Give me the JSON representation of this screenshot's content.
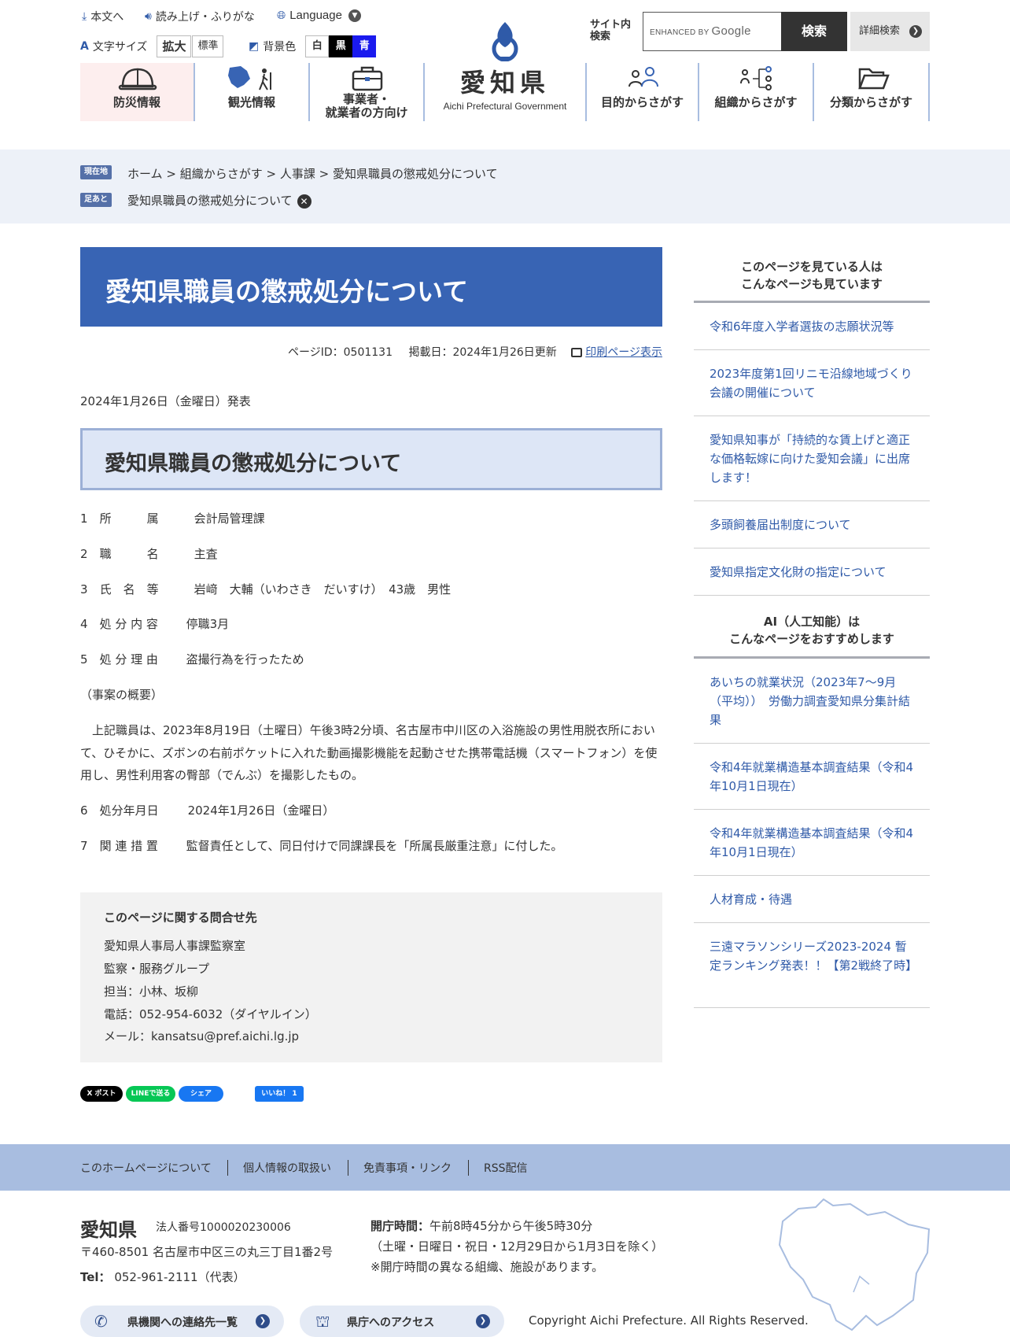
{
  "header": {
    "skip": "本文へ",
    "read_aloud": "読み上げ・ふりがな",
    "language": "Language",
    "font_size_label": "文字サイズ",
    "font_large": "拡大",
    "font_standard": "標準",
    "bg_color_label": "背景色",
    "bg_white": "白",
    "bg_black": "黒",
    "bg_blue": "青",
    "logo_jp": "愛知県",
    "logo_en": "Aichi Prefectural Government",
    "search_label_1": "サイト内",
    "search_label_2": "検索",
    "search_enhanced": "ENHANCED BY",
    "search_google": "Google",
    "search_button": "検索",
    "advanced_search": "詳細検索"
  },
  "nav": {
    "bosai": "防災情報",
    "kanko": "観光情報",
    "jigyo_1": "事業者・",
    "jigyo_2": "就業者の方向け",
    "mokuteki": "目的からさがす",
    "soshiki": "組織からさがす",
    "bunrui": "分類からさがす"
  },
  "breadcrumb": {
    "current_tag": "現在地",
    "home": "ホーム",
    "org": "組織からさがす",
    "dept": "人事課",
    "page": "愛知県職員の懲戒処分について",
    "sep": ">",
    "history_tag": "足あと",
    "history_item": "愛知県職員の懲戒処分について"
  },
  "article": {
    "title": "愛知県職員の懲戒処分について",
    "page_id": "ページID：0501131",
    "posted": "掲載日：2024年1月26日更新",
    "print": "印刷ページ表示",
    "announce": "2024年1月26日（金曜日）発表",
    "heading": "愛知県職員の懲戒処分について",
    "items": [
      {
        "num": "1",
        "label": "所　　　属",
        "value": "会計局管理課"
      },
      {
        "num": "2",
        "label": "職　　　名",
        "value": "主査"
      },
      {
        "num": "3",
        "label": "氏　名　等",
        "value": "岩﨑　大輔（いわさき　だいすけ）　43歳　男性"
      },
      {
        "num": "4",
        "label": "処 分 内 容",
        "value": "停職3月"
      },
      {
        "num": "5",
        "label": "処 分 理 由",
        "value": "盗撮行為を行ったため"
      }
    ],
    "summary_label": "（事案の概要）",
    "summary": "　上記職員は、2023年8月19日（土曜日）午後3時2分頃、名古屋市中川区の入浴施設の男性用脱衣所において、ひそかに、ズボンの右前ポケットに入れた動画撮影機能を起動させた携帯電話機（スマートフォン）を使用し、男性利用客の臀部（でんぶ）を撮影したもの。",
    "items2": [
      {
        "num": "6",
        "label": "処分年月日",
        "value": "2024年1月26日（金曜日）"
      },
      {
        "num": "7",
        "label": "関 連 措 置",
        "value": "監督責任として、同日付けで同課課長を「所属長厳重注意」に付した。"
      }
    ]
  },
  "contact": {
    "title": "このページに関する問合せ先",
    "lines": [
      "愛知県人事局人事課監察室",
      "監察・服務グループ",
      "担当：小林、坂柳",
      "電話：052-954-6032（ダイヤルイン）",
      "メール：kansatsu@pref.aichi.lg.jp"
    ]
  },
  "sns": {
    "x": "X ポスト",
    "line": "LINEで送る",
    "facebook": "シェア",
    "like": "いいね！ 1"
  },
  "sidebar": {
    "head1_line1": "このページを見ている人は",
    "head1_line2": "こんなページも見ています",
    "links1": [
      "令和6年度入学者選抜の志願状況等",
      "2023年度第1回リニモ沿線地域づくり会議の開催について",
      "愛知県知事が「持続的な賃上げと適正な価格転嫁に向けた愛知会議」に出席します！",
      "多頭飼養届出制度について",
      "愛知県指定文化財の指定について"
    ],
    "head2_line1": "AI（人工知能）は",
    "head2_line2": "こんなページをおすすめします",
    "links2": [
      "あいちの就業状況（2023年7～9月（平均））　労働力調査愛知県分集計結果",
      "令和4年就業構造基本調査結果（令和4年10月1日現在）",
      "令和4年就業構造基本調査結果（令和4年10月1日現在）",
      "人材育成・待遇",
      "三遠マラソンシリーズ2023-2024 暫定ランキング発表！！【第2戦終了時】"
    ]
  },
  "footer": {
    "links": [
      "このホームページについて",
      "個人情報の取扱い",
      "免責事項・リンク",
      "RSS配信"
    ],
    "name": "愛知県",
    "corp_no": "法人番号1000020230006",
    "address": "〒460-8501 名古屋市中区三の丸三丁目1番2号",
    "tel_label": "Tel：",
    "tel": "052-961-2111（代表）",
    "hours_label": "開庁時間：",
    "hours": "午前8時45分から午後5時30分",
    "hours_note1": "（土曜・日曜日・祝日・12月29日から1月3日を除く）",
    "hours_note2": "※開庁時間の異なる組織、施設があります。",
    "btn_contact": "県機関への連絡先一覧",
    "btn_access": "県庁へのアクセス",
    "copyright": "Copyright Aichi Prefecture. All Rights Reserved."
  },
  "colors": {
    "brand_blue": "#3864b4",
    "link": "#2f5aa8",
    "footer_band": "#a8bde0"
  }
}
